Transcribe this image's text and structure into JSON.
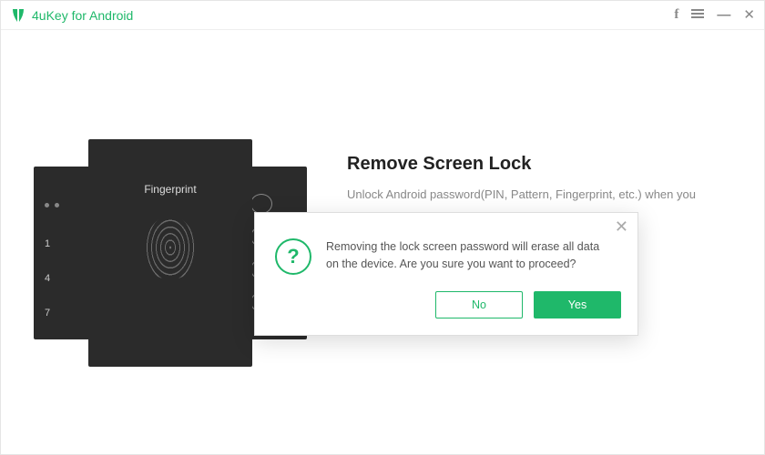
{
  "titlebar": {
    "app_name": "4uKey for Android"
  },
  "headline": {
    "title": "Remove Screen Lock",
    "subtitle": "Unlock Android password(PIN, Pattern, Fingerprint, etc.) when you"
  },
  "devices": {
    "pin_keys": [
      "1",
      "4",
      "7"
    ],
    "fingerprint_label": "Fingerprint"
  },
  "modal": {
    "icon_glyph": "?",
    "message": "Removing the lock screen password will erase all data on the device. Are you sure you want to proceed?",
    "no_label": "No",
    "yes_label": "Yes"
  }
}
